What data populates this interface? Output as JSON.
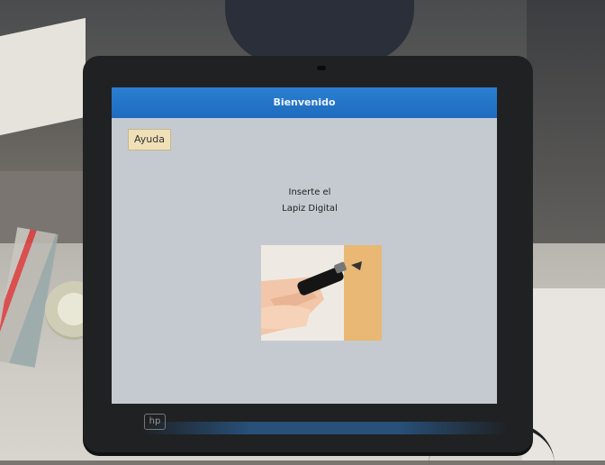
{
  "window": {
    "title": "Bienvenido"
  },
  "help": {
    "label": "Ayuda"
  },
  "instructions": {
    "line1": "Inserte el",
    "line2": "Lapiz Digital"
  },
  "device": {
    "logo_text": "hp"
  },
  "illustration": {
    "description_icon": "pen-insert-image"
  },
  "colors": {
    "titlebar": "#1e6bbf",
    "screen": "#c5cad0",
    "help_button": "#efe0b8",
    "bezel": "#1f2123"
  }
}
